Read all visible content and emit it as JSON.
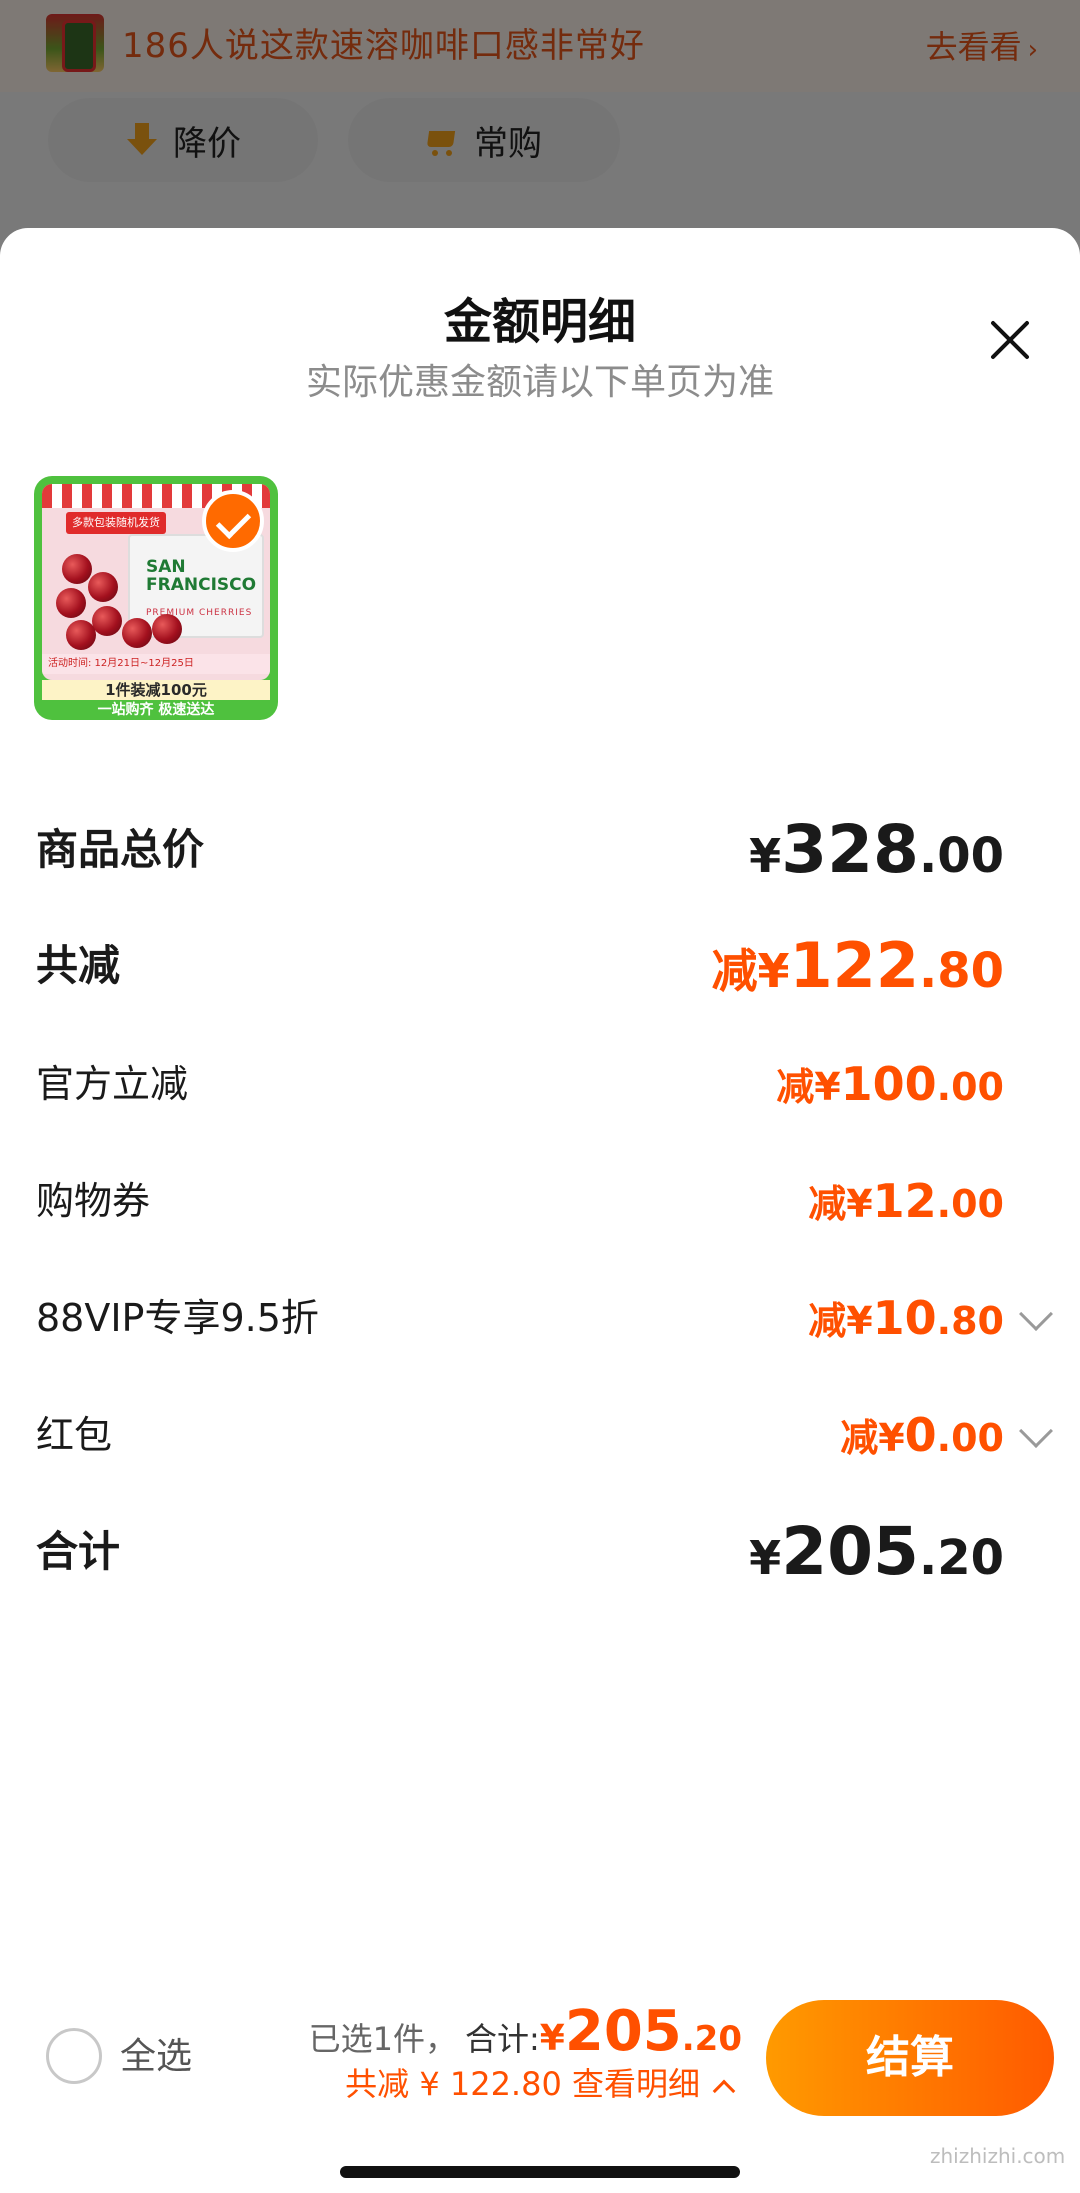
{
  "promo": {
    "text": "186人说这款速溶咖啡口感非常好",
    "link": "去看看",
    "link_chevron": "›"
  },
  "pills": {
    "price_drop": "降价",
    "frequent": "常购"
  },
  "sheet": {
    "title": "金额明细",
    "subtitle": "实际优惠金额请以下单页为准"
  },
  "product": {
    "tag": "多款包装随机发货",
    "logo": "SAN FRANCISCO",
    "logo_sub": "PREMIUM CHERRIES",
    "date": "活动时间: 12月21日~12月25日",
    "promo": "1件装减100元",
    "footer": "一站购齐 极速送达",
    "selected": true
  },
  "rows": [
    {
      "label": "商品总价",
      "prefix": "¥",
      "int": "328",
      "dec": ".00"
    },
    {
      "label": "共减",
      "prefix": "减¥",
      "int": "122",
      "dec": ".80"
    },
    {
      "label": "官方立减",
      "prefix": "减¥",
      "int": "100",
      "dec": ".00"
    },
    {
      "label": "购物券",
      "prefix": "减¥",
      "int": "12",
      "dec": ".00"
    },
    {
      "label": "88VIP专享9.5折",
      "prefix": "减¥",
      "int": "10",
      "dec": ".80"
    },
    {
      "label": "红包",
      "prefix": "减¥",
      "int": "0",
      "dec": ".00"
    },
    {
      "label": "合计",
      "prefix": "¥",
      "int": "205",
      "dec": ".20"
    }
  ],
  "footer": {
    "select_all": "全选",
    "selected_count": "已选1件，",
    "total_label": "合计:",
    "total_currency": "¥",
    "total_int": "205",
    "total_dec": ".20",
    "saved_text": "共减 ¥ 122.80  查看明细",
    "checkout": "结算"
  },
  "watermark": "zhizhizhi.com",
  "colors": {
    "accent": "#ff5000",
    "promo_text": "#e9561a",
    "product_green": "#4fc13e"
  },
  "icons": [
    "close-icon",
    "chevron-down-icon",
    "chevron-up-icon",
    "checkmark-icon",
    "arrow-down-icon",
    "cart-icon"
  ]
}
